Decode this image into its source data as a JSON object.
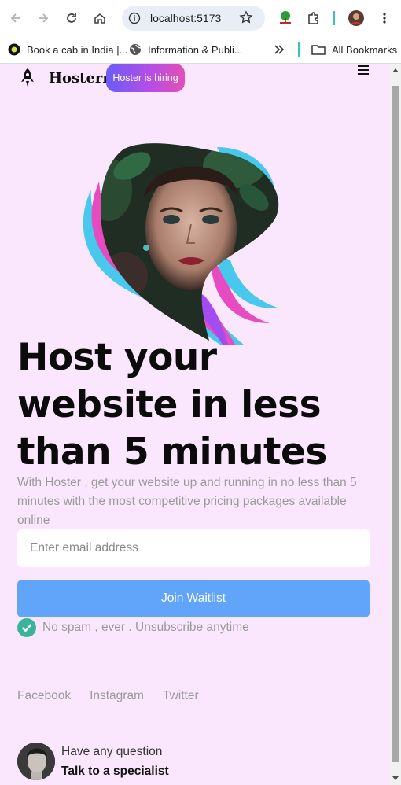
{
  "browser": {
    "url": "localhost:5173",
    "bookmarks": [
      {
        "label": "Book a cab in India |...",
        "icon": "ola-icon"
      },
      {
        "label": "Information & Publi...",
        "icon": "globe-icon"
      }
    ],
    "all_bookmarks_label": "All Bookmarks"
  },
  "nav": {
    "brand": "Hosterr",
    "hiring_badge": "Hoster is hiring"
  },
  "hero": {
    "headline": "Host your website in less than 5 minutes",
    "subtitle": "With Hoster , get your website up and running in no less than 5 minutes with the most competitive pricing packages available online",
    "email_placeholder": "Enter email address",
    "join_label": "Join Waitlist",
    "no_spam": "No spam , ever . Unsubscribe anytime"
  },
  "socials": [
    "Facebook",
    "Instagram",
    "Twitter"
  ],
  "specialist": {
    "question": "Have any question",
    "cta": "Talk to a specialist"
  },
  "colors": {
    "page_bg": "#fbe7fd",
    "join_button": "#60a5fa",
    "check": "#3bb39b",
    "hiring_start": "#6a5cf5",
    "hiring_end": "#e44fb2"
  }
}
